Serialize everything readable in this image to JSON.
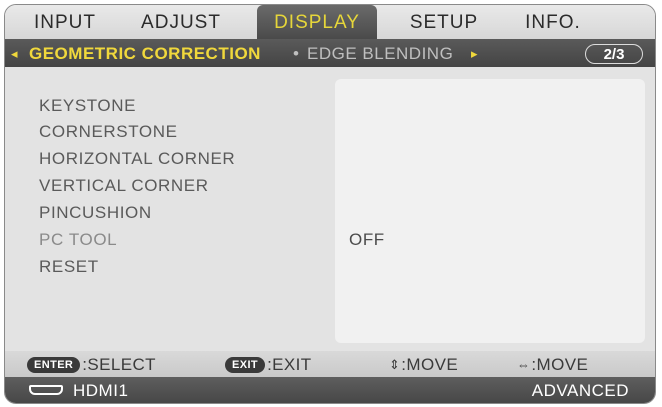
{
  "colors": {
    "active_tab_text": "#e6d63a",
    "subbar_active": "#f0d83c",
    "subbar_inactive": "#bfbfbf",
    "menu_text": "#5a5a5a",
    "menu_text_dim": "#8a8a8a"
  },
  "tabs": [
    {
      "label": "INPUT"
    },
    {
      "label": "ADJUST"
    },
    {
      "label": "DISPLAY"
    },
    {
      "label": "SETUP"
    },
    {
      "label": "INFO."
    }
  ],
  "subbar": {
    "left_arrow": "◂",
    "active_label": "GEOMETRIC CORRECTION",
    "separator": "•",
    "inactive_label": "EDGE BLENDING",
    "right_arrow": "▸",
    "page_indicator": "2/3"
  },
  "menu": {
    "items": [
      {
        "label": "KEYSTONE",
        "value": ""
      },
      {
        "label": "CORNERSTONE",
        "value": ""
      },
      {
        "label": "HORIZONTAL CORNER",
        "value": ""
      },
      {
        "label": "VERTICAL CORNER",
        "value": ""
      },
      {
        "label": "PINCUSHION",
        "value": ""
      },
      {
        "label": "PC TOOL",
        "value": "OFF"
      },
      {
        "label": "RESET",
        "value": ""
      }
    ]
  },
  "footer": {
    "enter_key": "ENTER",
    "select_label": ":SELECT",
    "exit_key": "EXIT",
    "exit_label": ":EXIT",
    "move_vertical_icon": "⇕",
    "move_vertical_label": ":MOVE",
    "move_horizontal_icon": "⇔",
    "move_horizontal_label": ":MOVE",
    "source_icon": "hdmi-icon",
    "source_label": "HDMI1",
    "mode_label": "ADVANCED"
  }
}
